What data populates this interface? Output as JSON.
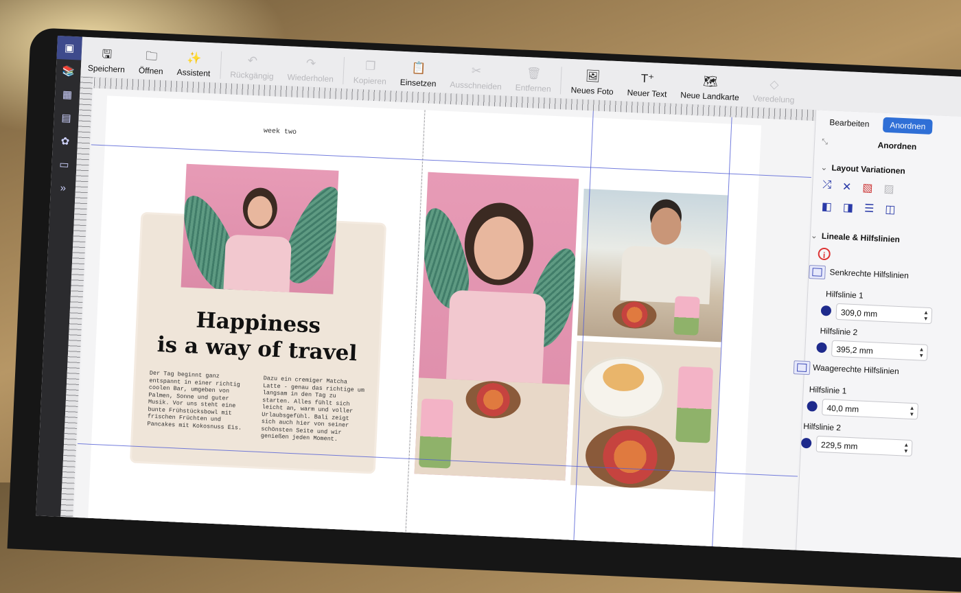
{
  "toolbar": {
    "items": [
      {
        "label": "Speichern",
        "icon": "save-icon",
        "glyph": "🖫",
        "enabled": true
      },
      {
        "label": "Öffnen",
        "icon": "folder-icon",
        "glyph": "🗀",
        "enabled": true
      },
      {
        "label": "Assistent",
        "icon": "magic-wand-icon",
        "glyph": "✨",
        "enabled": true
      },
      {
        "label": "Rückgängig",
        "icon": "undo-icon",
        "glyph": "↶",
        "enabled": false
      },
      {
        "label": "Wiederholen",
        "icon": "redo-icon",
        "glyph": "↷",
        "enabled": false
      },
      {
        "label": "Kopieren",
        "icon": "copy-icon",
        "glyph": "❐",
        "enabled": false
      },
      {
        "label": "Einsetzen",
        "icon": "paste-icon",
        "glyph": "📋",
        "enabled": true
      },
      {
        "label": "Ausschneiden",
        "icon": "scissors-icon",
        "glyph": "✂",
        "enabled": false
      },
      {
        "label": "Entfernen",
        "icon": "trash-icon",
        "glyph": "🗑",
        "enabled": false
      },
      {
        "label": "Neues Foto",
        "icon": "add-photo-icon",
        "glyph": "🖼",
        "enabled": true
      },
      {
        "label": "Neuer Text",
        "icon": "add-text-icon",
        "glyph": "T⁺",
        "enabled": true
      },
      {
        "label": "Neue Landkarte",
        "icon": "add-map-icon",
        "glyph": "🗺",
        "enabled": true
      },
      {
        "label": "Veredelung",
        "icon": "diamond-icon",
        "glyph": "◇",
        "enabled": false
      }
    ]
  },
  "rail": [
    "layout-icon",
    "books-icon",
    "layout-grid-icon",
    "color-stripes-icon",
    "flower-icon",
    "monitor-icon",
    "expand-icon"
  ],
  "page": {
    "header": "week two",
    "headline_line1": "Happiness",
    "headline_line2": "is a way of travel",
    "col1": "Der Tag beginnt ganz entspannt in einer richtig coolen Bar, umgeben von Palmen, Sonne und guter Musik. Vor uns steht eine bunte Frühstücksbowl mit frischen Früchten und Pancakes mit Kokosnuss Eis.",
    "col2": "Dazu ein cremiger Matcha Latte - genau das richtige um langsam in den Tag zu starten. Alles fühlt sich leicht an, warm und voller Urlaubsgefühl. Bali zeigt sich auch hier von seiner schönsten Seite und wir genießen jeden Moment."
  },
  "panel": {
    "tabs": [
      "Bearbeiten",
      "Anordnen"
    ],
    "active_tab": "Anordnen",
    "title": "Anordnen",
    "section_layout": "Layout Variationen",
    "section_rulers": "Lineale & Hilfslinien",
    "vertical_label": "Senkrechte Hilfslinien",
    "horizontal_label": "Waagerechte Hilfslinien",
    "v_guide1_label": "Hilfslinie 1",
    "v_guide1_value": "309,0 mm",
    "v_guide2_label": "Hilfslinie 2",
    "v_guide2_value": "395,2 mm",
    "h_guide1_label": "Hilfslinie 1",
    "h_guide1_value": "40,0 mm",
    "h_guide2_label": "Hilfslinie 2",
    "h_guide2_value": "229,5 mm",
    "guide_color": "#1e2a8c"
  },
  "colors": {
    "accent": "#2f6fd6",
    "guide": "#4f5bd5"
  }
}
